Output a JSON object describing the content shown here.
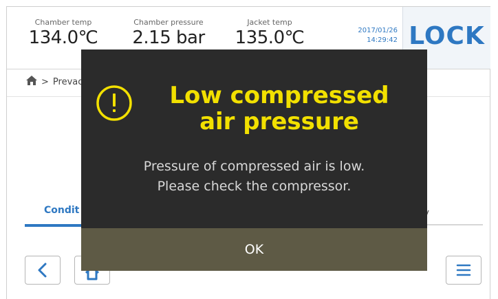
{
  "header": {
    "chamber_temp": {
      "label": "Chamber temp",
      "value": "134.0℃"
    },
    "chamber_pressure": {
      "label": "Chamber pressure",
      "value": "2.15 bar"
    },
    "jacket_temp": {
      "label": "Jacket temp",
      "value": "135.0℃"
    },
    "date": "2017/01/26",
    "time": "14:29:42",
    "lock_label": "LOCK"
  },
  "breadcrumb": {
    "separator": ">",
    "current": "Prevac"
  },
  "tabs": {
    "left_label": "Condit",
    "right_label": "ry"
  },
  "modal": {
    "title_line1": "Low compressed",
    "title_line2": "air pressure",
    "message_line1": "Pressure of compressed air is low.",
    "message_line2": "Please check the compressor.",
    "ok_label": "OK",
    "icon": "warning-exclamation-icon"
  },
  "colors": {
    "accent": "#2e78c2",
    "modal_bg": "#2b2b2b",
    "title_yellow": "#f2e000",
    "ok_bar": "#5e5a45"
  }
}
